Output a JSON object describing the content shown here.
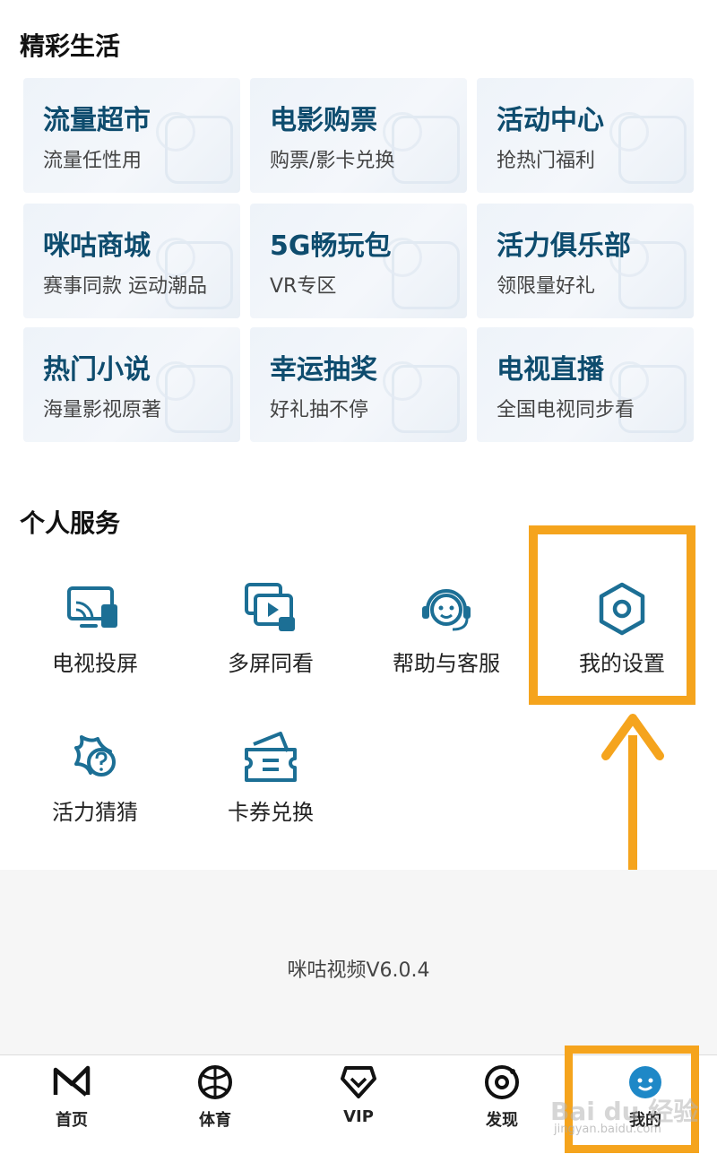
{
  "sections": {
    "lifestyle_title": "精彩生活",
    "services_title": "个人服务"
  },
  "cards": [
    {
      "title": "流量超市",
      "subtitle": "流量任性用"
    },
    {
      "title": "电影购票",
      "subtitle": "购票/影卡兑换"
    },
    {
      "title": "活动中心",
      "subtitle": "抢热门福利"
    },
    {
      "title": "咪咕商城",
      "subtitle": "赛事同款 运动潮品"
    },
    {
      "title": "5G畅玩包",
      "subtitle": "VR专区"
    },
    {
      "title": "活力俱乐部",
      "subtitle": "领限量好礼"
    },
    {
      "title": "热门小说",
      "subtitle": "海量影视原著"
    },
    {
      "title": "幸运抽奖",
      "subtitle": "好礼抽不停"
    },
    {
      "title": "电视直播",
      "subtitle": "全国电视同步看"
    }
  ],
  "services": [
    {
      "label": "电视投屏",
      "icon": "tv-cast-icon"
    },
    {
      "label": "多屏同看",
      "icon": "multi-screen-icon"
    },
    {
      "label": "帮助与客服",
      "icon": "customer-service-icon"
    },
    {
      "label": "我的设置",
      "icon": "settings-icon"
    },
    {
      "label": "活力猜猜",
      "icon": "quiz-icon"
    },
    {
      "label": "卡券兑换",
      "icon": "coupon-icon"
    }
  ],
  "version": "咪咕视频V6.0.4",
  "tabs": [
    {
      "label": "首页",
      "icon": "home-logo-icon"
    },
    {
      "label": "体育",
      "icon": "basketball-icon"
    },
    {
      "label": "VIP",
      "icon": "vip-icon"
    },
    {
      "label": "发现",
      "icon": "discover-icon"
    },
    {
      "label": "我的",
      "icon": "profile-avatar-icon"
    }
  ],
  "watermark": {
    "main": "Bai du 经验",
    "sub": "jingyan.baidu.com"
  },
  "colors": {
    "highlight": "#f5a41d",
    "card_title": "#0e4c6e",
    "icon": "#1c6f95"
  }
}
